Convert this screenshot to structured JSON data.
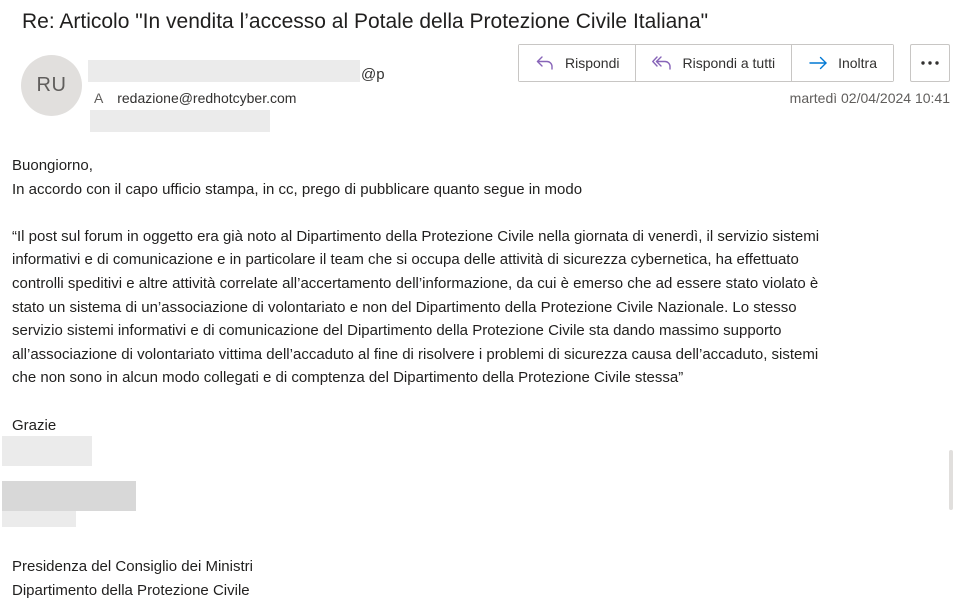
{
  "email": {
    "subject": "Re: Articolo \"In vendita l’accesso al Potale della Protezione Civile Italiana\"",
    "avatar_initials": "RU",
    "sender_suffix": "@p",
    "to_label": "A",
    "to_address": "redazione@redhotcyber.com",
    "date": "martedì 02/04/2024 10:41"
  },
  "actions": {
    "reply": {
      "label": "Rispondi",
      "icon": "reply-icon"
    },
    "reply_all": {
      "label": "Rispondi a tutti",
      "icon": "reply-all-icon"
    },
    "forward": {
      "label": "Inoltra",
      "icon": "forward-arrow-icon"
    },
    "more": {
      "icon": "more-ellipsis-icon"
    }
  },
  "colors": {
    "accent": "#8764b8",
    "forward_accent": "#0078d4",
    "avatar_bg": "#e1dfdd"
  },
  "body": {
    "greeting": "Buongiorno,",
    "line1": "In accordo con il capo ufficio stampa, in cc, prego di pubblicare quanto segue in modo",
    "quote_lines": [
      "“Il post sul forum in oggetto era già noto al Dipartimento della Protezione Civile nella giornata di venerdì, il servizio sistemi",
      "informativi e di comunicazione e in particolare il team che si occupa delle attività di sicurezza cybernetica,  ha effettuato",
      "controlli speditivi e altre attività correlate all’accertamento dell’informazione, da cui è emerso che ad essere stato violato è",
      "stato un sistema di un’associazione di volontariato e non del Dipartimento della Protezione Civile Nazionale. Lo stesso",
      "servizio sistemi informativi e di comunicazione del Dipartimento della Protezione Civile sta dando massimo supporto",
      "all’associazione di volontariato vittima dell’accaduto al fine di risolvere i problemi di sicurezza causa dell’accaduto, sistemi",
      "che non sono in alcun modo collegati e di comptenza del Dipartimento della Protezione Civile stessa”"
    ],
    "closing": "Grazie",
    "org_line1": "Presidenza del Consiglio dei Ministri",
    "org_line2": "Dipartimento della Protezione Civile"
  }
}
